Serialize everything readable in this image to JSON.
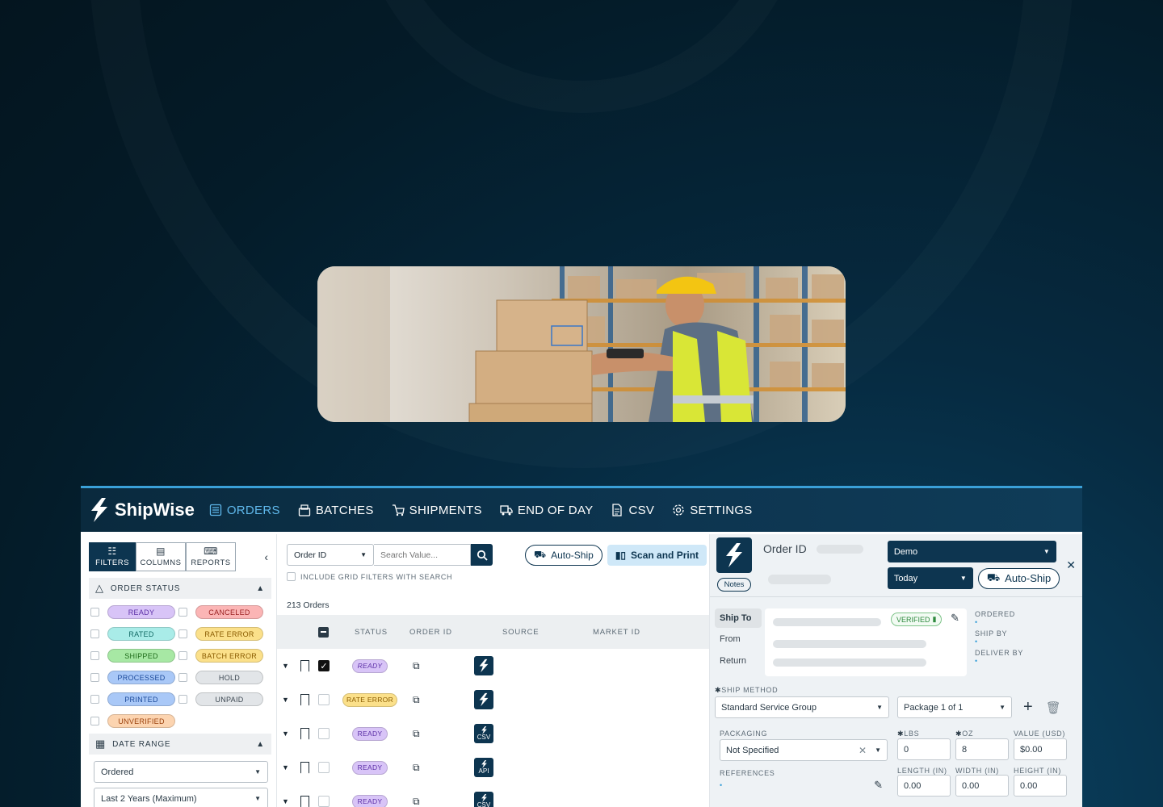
{
  "nav": {
    "brand": "ShipWise",
    "items": [
      {
        "label": "ORDERS",
        "icon": "list-icon",
        "active": true
      },
      {
        "label": "BATCHES",
        "icon": "batches-icon",
        "active": false
      },
      {
        "label": "SHIPMENTS",
        "icon": "cart-icon",
        "active": false
      },
      {
        "label": "END OF DAY",
        "icon": "truck-icon",
        "active": false
      },
      {
        "label": "CSV",
        "icon": "file-icon",
        "active": false
      },
      {
        "label": "SETTINGS",
        "icon": "gear-icon",
        "active": false
      }
    ]
  },
  "sidebar": {
    "tabs": [
      {
        "label": "FILTERS",
        "icon": "filter-icon"
      },
      {
        "label": "COLUMNS",
        "icon": "columns-icon"
      },
      {
        "label": "REPORTS",
        "icon": "reports-icon"
      }
    ],
    "order_status_title": "ORDER STATUS",
    "statuses": [
      {
        "label": "READY",
        "bg": "#d8c4f7",
        "fg": "#5b2ea6"
      },
      {
        "label": "CANCELED",
        "bg": "#fbb5b5",
        "fg": "#9a1f1f"
      },
      {
        "label": "RATED",
        "bg": "#a9ece8",
        "fg": "#136b66"
      },
      {
        "label": "RATE ERROR",
        "bg": "#fbe08a",
        "fg": "#8a5b00"
      },
      {
        "label": "SHIPPED",
        "bg": "#a7e8a4",
        "fg": "#1e6b1a"
      },
      {
        "label": "BATCH ERROR",
        "bg": "#fbe08a",
        "fg": "#8a5b00"
      },
      {
        "label": "PROCESSED",
        "bg": "#a9c8f7",
        "fg": "#1c4a9a"
      },
      {
        "label": "HOLD",
        "bg": "#e2e5e8",
        "fg": "#3b4650"
      },
      {
        "label": "PRINTED",
        "bg": "#a9c8f7",
        "fg": "#1c4a9a"
      },
      {
        "label": "UNPAID",
        "bg": "#e2e5e8",
        "fg": "#3b4650"
      },
      {
        "label": "UNVERIFIED",
        "bg": "#fcd4b0",
        "fg": "#9a3f0a"
      }
    ],
    "date_range_title": "DATE RANGE",
    "date_type": "Ordered",
    "date_range": "Last 2 Years (Maximum)"
  },
  "orders": {
    "search_field": "Order ID",
    "search_placeholder": "Search Value...",
    "include_label": "INCLUDE GRID FILTERS WITH SEARCH",
    "auto_ship": "Auto-Ship",
    "scan_print": "Scan and Print",
    "count": "213 Orders",
    "columns": [
      "STATUS",
      "ORDER ID",
      "SOURCE",
      "MARKET ID"
    ],
    "rows": [
      {
        "status": "READY",
        "bg": "#d8c4f7",
        "fg": "#5b2ea6",
        "source": "shipwise",
        "source_label": "",
        "checked": true
      },
      {
        "status": "RATE ERROR",
        "bg": "#fbe08a",
        "fg": "#8a5b00",
        "source": "shipwise",
        "source_label": "",
        "checked": false
      },
      {
        "status": "READY",
        "bg": "#d8c4f7",
        "fg": "#5b2ea6",
        "source": "csv",
        "source_label": "CSV",
        "checked": false
      },
      {
        "status": "READY",
        "bg": "#d8c4f7",
        "fg": "#5b2ea6",
        "source": "api",
        "source_label": "API",
        "checked": false
      },
      {
        "status": "READY",
        "bg": "#d8c4f7",
        "fg": "#5b2ea6",
        "source": "csv",
        "source_label": "CSV",
        "checked": false
      }
    ]
  },
  "details": {
    "notes": "Notes",
    "order_id_label": "Order ID",
    "account": "Demo",
    "date": "Today",
    "auto_ship": "Auto-Ship",
    "ship_to": "Ship To",
    "from": "From",
    "return": "Return",
    "verified": "VERIFIED",
    "ordered": "ORDERED",
    "ship_by": "SHIP BY",
    "deliver_by": "DELIVER BY",
    "ship_method_label": "SHIP METHOD",
    "ship_method": "Standard Service Group",
    "package": "Package 1 of 1",
    "packaging_label": "PACKAGING",
    "packaging": "Not Specified",
    "lbs_label": "LBS",
    "lbs": "0",
    "oz_label": "OZ",
    "oz": "8",
    "value_label": "VALUE (USD)",
    "value": "$0.00",
    "references_label": "REFERENCES",
    "length_label": "LENGTH (IN)",
    "length": "0.00",
    "width_label": "WIDTH (IN)",
    "width": "0.00",
    "height_label": "HEIGHT (IN)",
    "height": "0.00"
  }
}
